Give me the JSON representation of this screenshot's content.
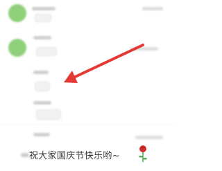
{
  "chat": {
    "last_message": "祝大家国庆节快乐哟~",
    "emoji_icon": "rose-icon"
  },
  "colors": {
    "avatar_green": "#8fd07a",
    "arrow_red": "#e53935",
    "rose_red": "#d32f2f",
    "leaf_green": "#4caf50"
  },
  "annotation": {
    "arrow_icon": "red-arrow-icon"
  }
}
